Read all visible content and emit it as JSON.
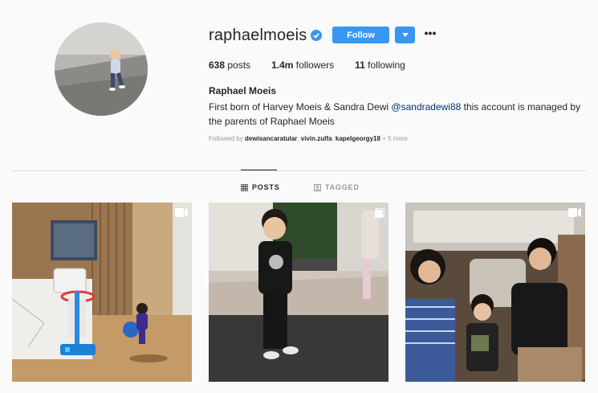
{
  "profile": {
    "username": "raphaelmoeis",
    "verified_icon": "verified-badge-icon",
    "follow_label": "Follow",
    "more_label": "•••",
    "full_name": "Raphael Moeis",
    "bio_prefix": "First born of Harvey Moeis & Sandra Dewi ",
    "bio_mention": "@sandradewi88",
    "bio_suffix": " this account is managed by the parents of Raphael Moeis",
    "followed_by_prefix": "Followed by ",
    "followed_by_users": [
      "dewisancaratular",
      "vivin.zulfa",
      "kapelgeorgy18"
    ],
    "followed_by_more": " + 5 more"
  },
  "stats": {
    "posts_count": "638",
    "posts_label": "posts",
    "followers_count": "1.4m",
    "followers_label": "followers",
    "following_count": "11",
    "following_label": "following"
  },
  "tabs": [
    {
      "label": "POSTS",
      "active": true,
      "icon": "grid-icon"
    },
    {
      "label": "TAGGED",
      "active": false,
      "icon": "tag-icon"
    }
  ],
  "posts": [
    {
      "type_icon": "video-icon"
    },
    {
      "type_icon": "multi-photo-icon"
    },
    {
      "type_icon": "video-icon"
    }
  ],
  "colors": {
    "accent": "#3897f0",
    "background": "#fafafa",
    "divider": "#dbdbdb",
    "mention": "#003569"
  }
}
